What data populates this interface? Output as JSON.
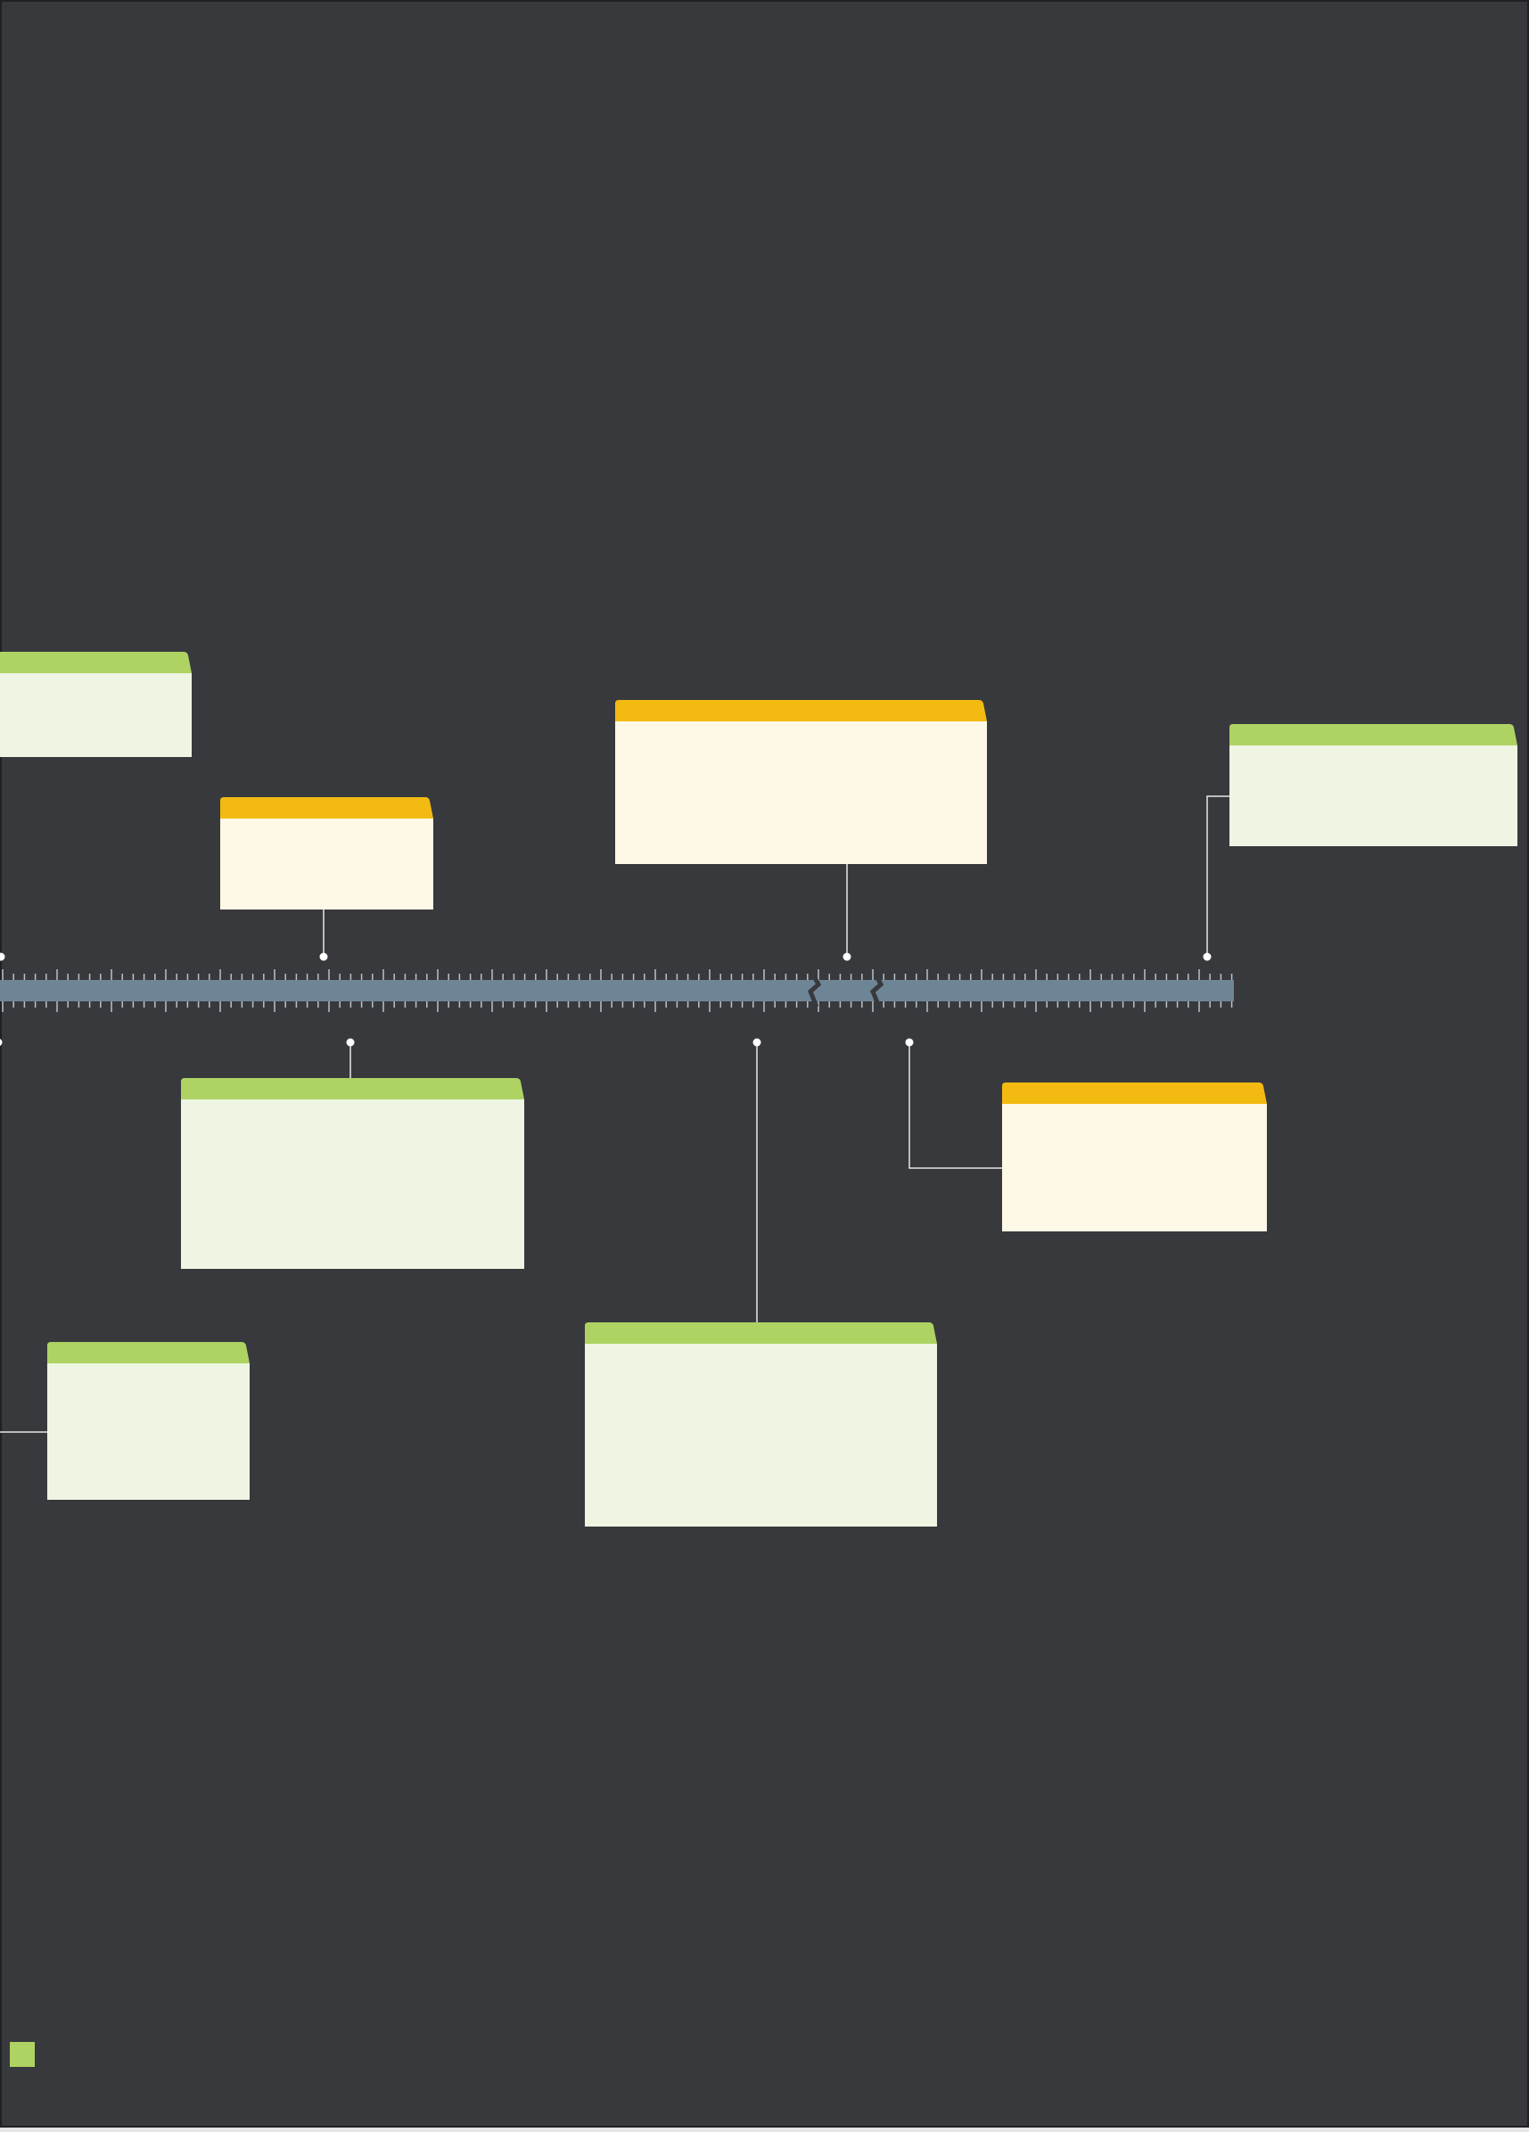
{
  "title": "",
  "colors": {
    "background": "#38393d",
    "frame": "#202124",
    "axis_band": "#6e8596",
    "ticks": "#b9c2c8",
    "connector": "#e8e8e8",
    "green_header": "#aed363",
    "green_body": "#eef5e2",
    "yellow_header": "#f3bb12",
    "yellow_body": "#fef8e6",
    "legend_swatch": "#aed363"
  },
  "axis": {
    "has_break": true
  },
  "events": [
    {
      "id": "event-1",
      "side": "above",
      "color": "green",
      "title": "",
      "text": ""
    },
    {
      "id": "event-2",
      "side": "above",
      "color": "yellow",
      "title": "",
      "text": ""
    },
    {
      "id": "event-3",
      "side": "above",
      "color": "yellow",
      "title": "",
      "text": ""
    },
    {
      "id": "event-4",
      "side": "above",
      "color": "green",
      "title": "",
      "text": ""
    },
    {
      "id": "event-5",
      "side": "below",
      "color": "green",
      "title": "",
      "text": ""
    },
    {
      "id": "event-6",
      "side": "below",
      "color": "green",
      "title": "",
      "text": ""
    },
    {
      "id": "event-7",
      "side": "below",
      "color": "green",
      "title": "",
      "text": ""
    },
    {
      "id": "event-8",
      "side": "below",
      "color": "yellow",
      "title": "",
      "text": ""
    }
  ],
  "legend": {
    "label": ""
  }
}
